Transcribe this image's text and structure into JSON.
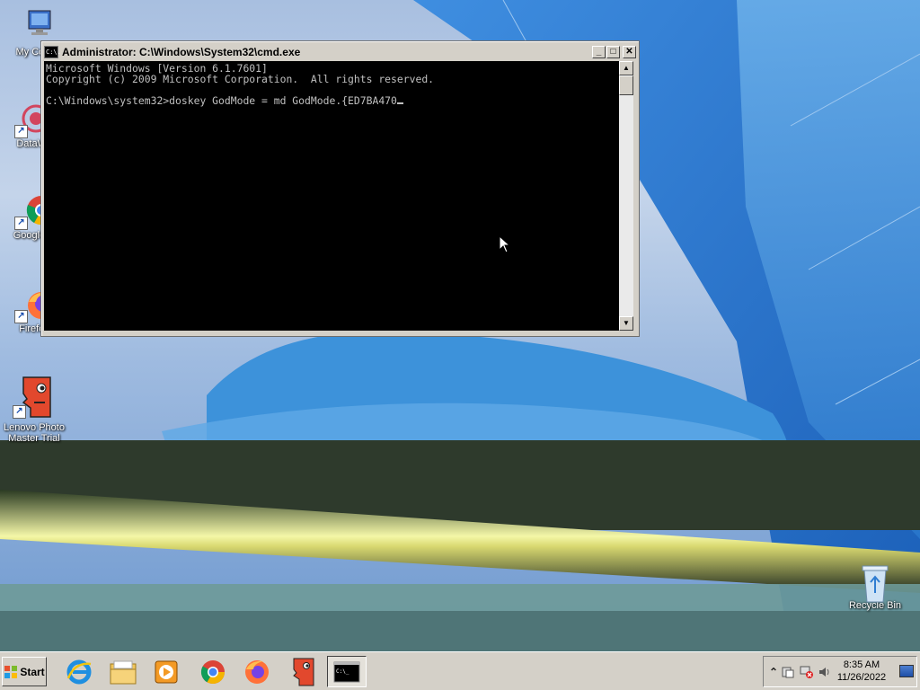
{
  "desktop": {
    "icons": [
      {
        "label": "My Computer",
        "visible": "My Com"
      },
      {
        "label": "DataWa",
        "visible": "DataWa"
      },
      {
        "label": "Google Chrome",
        "visible": "Google C"
      },
      {
        "label": "Firefox",
        "visible": "Firefox"
      },
      {
        "label_line1": "Lenovo Photo",
        "label_line2": "Master Trial"
      },
      {
        "label": "Recycle Bin"
      }
    ]
  },
  "cmd": {
    "title": "Administrator: C:\\Windows\\System32\\cmd.exe",
    "icon_text": "C:\\.",
    "lines": [
      "Microsoft Windows [Version 6.1.7601]",
      "Copyright (c) 2009 Microsoft Corporation.  All rights reserved.",
      "",
      "C:\\Windows\\system32>doskey GodMode = md GodMode.{ED7BA470"
    ],
    "minimize": "_",
    "maximize": "□",
    "close": "✕"
  },
  "taskbar": {
    "start_label": "Start",
    "apps": [
      {
        "name": "internet-explorer-icon"
      },
      {
        "name": "file-explorer-icon"
      },
      {
        "name": "media-player-icon"
      },
      {
        "name": "chrome-icon"
      },
      {
        "name": "firefox-icon"
      },
      {
        "name": "lenovo-photo-master-icon"
      },
      {
        "name": "cmd-icon",
        "active": true
      }
    ],
    "tray": {
      "chevron": "⌃",
      "time": "8:35 AM",
      "date": "11/26/2022"
    }
  },
  "colors": {
    "console_bg": "#000000",
    "console_fg": "#c0c0c0",
    "chrome_face": "#d4d0c8"
  }
}
